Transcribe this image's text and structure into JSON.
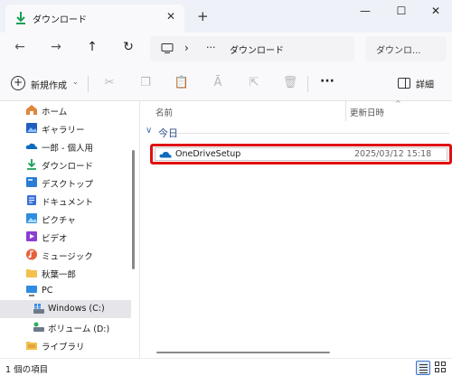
{
  "window": {
    "tab_title": "ダウンロード",
    "tab_close": "✕",
    "new_tab": "+",
    "minimize": "—",
    "maximize": "☐",
    "close": "✕"
  },
  "navigation": {
    "back": "←",
    "forward": "→",
    "up": "↑",
    "refresh": "↻",
    "address": {
      "separator": "›",
      "more": "···",
      "current_folder": "ダウンロード"
    },
    "search_placeholder": "ダウンロ..."
  },
  "toolbar": {
    "new_label": "新規作成",
    "new_caret": "⌄",
    "more": "···",
    "details_label": "詳細"
  },
  "sidebar": {
    "items": [
      {
        "label": "ホーム",
        "icon": "home-icon"
      },
      {
        "label": "ギャラリー",
        "icon": "gallery-icon"
      },
      {
        "label": "一郎 - 個人用",
        "icon": "onedrive-icon"
      },
      {
        "label": "ダウンロード",
        "icon": "download-icon"
      },
      {
        "label": "デスクトップ",
        "icon": "desktop-icon"
      },
      {
        "label": "ドキュメント",
        "icon": "documents-icon"
      },
      {
        "label": "ピクチャ",
        "icon": "pictures-icon"
      },
      {
        "label": "ビデオ",
        "icon": "videos-icon"
      },
      {
        "label": "ミュージック",
        "icon": "music-icon"
      },
      {
        "label": "秋葉一郎",
        "icon": "folder-icon"
      },
      {
        "label": "PC",
        "icon": "pc-icon"
      },
      {
        "label": "Windows (C:)",
        "icon": "drive-c-icon"
      },
      {
        "label": "ボリューム (D:)",
        "icon": "drive-d-icon"
      },
      {
        "label": "ライブラリ",
        "icon": "library-icon"
      }
    ]
  },
  "content": {
    "columns": [
      "名前",
      "更新日時"
    ],
    "sort_caret": "^",
    "group_caret": "∨",
    "group_label": "今日",
    "files": [
      {
        "name": "OneDriveSetup",
        "modified": "2025/03/12 15:18",
        "icon": "onedrive-icon"
      }
    ]
  },
  "status": {
    "item_count": "1 個の項目"
  },
  "colors": {
    "accent": "#0067c0",
    "highlight_border": "#e01010",
    "selected_nav": "#e5e5ea"
  }
}
